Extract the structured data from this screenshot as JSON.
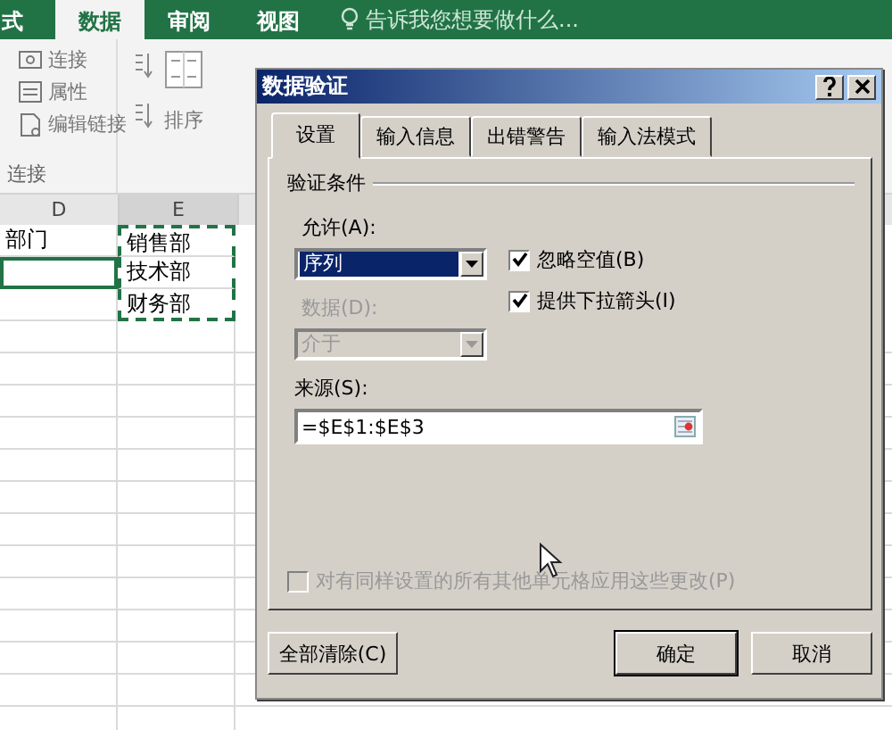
{
  "ribbon_tabs": [
    {
      "label": "式",
      "selected": false
    },
    {
      "label": "数据",
      "selected": true
    },
    {
      "label": "审阅",
      "selected": false
    },
    {
      "label": "视图",
      "selected": false
    }
  ],
  "tell_me": {
    "placeholder": "告诉我您想要做什么..."
  },
  "connections": {
    "items": [
      "连接",
      "属性",
      "编辑链接"
    ],
    "group_label": "连接"
  },
  "sort": {
    "label": "排序"
  },
  "sheet": {
    "columns": [
      "D",
      "E"
    ],
    "rows": [
      {
        "cells": [
          {
            "text": "部门",
            "selected": false,
            "copied": false
          },
          {
            "text": "销售部",
            "selected": false,
            "copied": true
          }
        ]
      },
      {
        "cells": [
          {
            "selected": true,
            "copied": false
          },
          {
            "text": "技术部",
            "selected": false,
            "copied": true
          }
        ]
      },
      {
        "cells": [
          {
            "selected": false,
            "copied": false
          },
          {
            "text": "财务部",
            "selected": false,
            "copied": true
          }
        ]
      }
    ]
  },
  "dialog": {
    "title": "数据验证",
    "tabs": [
      {
        "label": "设置",
        "selected": true
      },
      {
        "label": "输入信息",
        "selected": false
      },
      {
        "label": "出错警告",
        "selected": false
      },
      {
        "label": "输入法模式",
        "selected": false
      }
    ],
    "group_title": "验证条件",
    "allow": {
      "label": "允许(A):",
      "value": "序列"
    },
    "ignore_blank": {
      "label": "忽略空值(B)",
      "checked": true
    },
    "in_cell_dropdown": {
      "label": "提供下拉箭头(I)",
      "checked": true
    },
    "data": {
      "label": "数据(D):",
      "value": "介于",
      "disabled": true
    },
    "source": {
      "label": "来源(S):",
      "value": "=$E$1:$E$3"
    },
    "apply_all": {
      "label": "对有同样设置的所有其他单元格应用这些更改(P)",
      "checked": false,
      "disabled": true
    },
    "buttons": [
      {
        "label": "全部清除(C)",
        "default": false
      },
      {
        "label": "确定",
        "default": true
      },
      {
        "label": "取消",
        "default": false
      }
    ]
  }
}
